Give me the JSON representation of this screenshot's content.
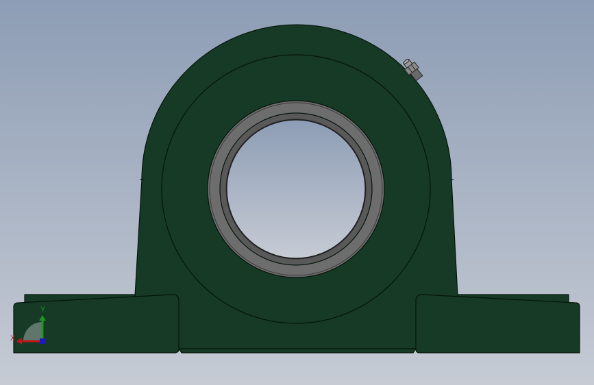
{
  "viewport": {
    "background_top": "#8d9db5",
    "background_bottom": "#c6cbd4",
    "model": {
      "name": "pillow-block-bearing",
      "body_color": "#163a26",
      "edge_color": "#05140b",
      "insert_ring_color": "#6d6d6d",
      "insert_inner_color": "#595959",
      "grease_fitting_color": "#7a7a7a"
    },
    "triad": {
      "x_label": "X",
      "y_label": "Y",
      "x_color": "#c01818",
      "y_color": "#1a9a1a",
      "z_color": "#1a1ac0"
    }
  }
}
